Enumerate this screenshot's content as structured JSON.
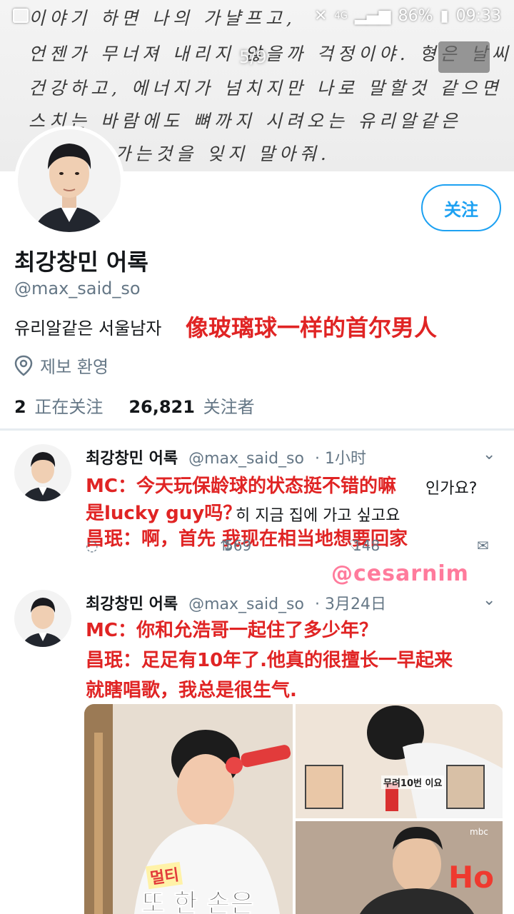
{
  "header": {
    "handwriting_lines": [
      "이야기 하면  나의   가냘프고,",
      "언젠가 무너져 내리지 않을까 걱정이야. 형은 날씨같고,",
      "건강하고, 에너지가 넘치지만  나로 말할것 같으면",
      "스치는  바람에도  뼈까지  시려오는  유리알같은",
      "  가는것을   잊지 말아줘."
    ],
    "page_indicator": "5/9"
  },
  "status_bar": {
    "battery": "86%",
    "time": "09:33",
    "network": "4G"
  },
  "profile": {
    "follow_label": "关注",
    "display_name": "최강창민 어록",
    "handle": "@max_said_so",
    "bio": "유리알같은 서울남자",
    "bio_translation": "像玻璃球一样的首尔男人",
    "location": "제보 환영",
    "following_count": "2",
    "following_label": "正在关注",
    "followers_count": "26,821",
    "followers_label": "关注者"
  },
  "tweets": [
    {
      "name": "최강창민 어록",
      "handle": "@max_said_so",
      "time": "· 1小时",
      "overlay_lines": [
        "MC：今天玩保龄球的状态挺不错的嘛",
        "是lucky guy吗？",
        "昌珉：啊，首先 我现在相当地想要回家"
      ],
      "under_text": [
        "인가요?",
        "히 지금 집에 가고 싶고요"
      ],
      "retweets": "569",
      "likes": "148"
    },
    {
      "name": "최강창민 어록",
      "handle": "@max_said_so",
      "time": "· 3月24日",
      "overlay_lines": [
        "MC：你和允浩哥一起住了多少年？",
        "昌珉：足足有10年了.他真的很擅长一早起来",
        "就瞎唱歌，我总是很生气."
      ]
    }
  ],
  "watermark": "@cesarnim",
  "media": {
    "caption_tag": "멀티",
    "caption_main": "또 한 손은",
    "inset_caption": "무려10번 이요",
    "tv_logo": "mbc",
    "big_letters": "Ho"
  },
  "colors": {
    "twitter_blue": "#1da1f2",
    "overlay_red": "#e02424",
    "watermark_pink": "#ff7b9c",
    "gray_text": "#657786"
  }
}
